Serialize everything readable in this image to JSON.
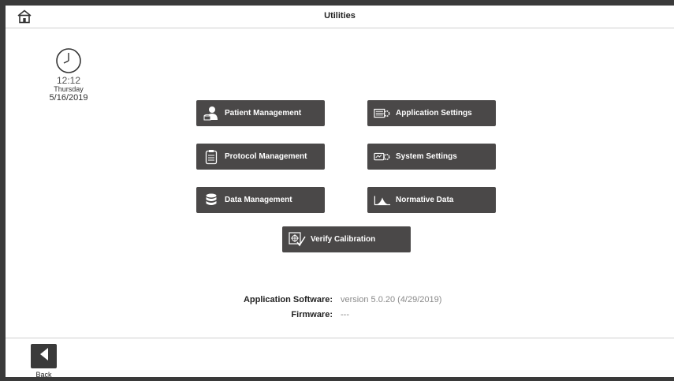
{
  "header": {
    "title": "Utilities",
    "home_icon": "home-icon"
  },
  "clock": {
    "time": "12:12",
    "day": "Thursday",
    "date": "5/16/2019",
    "icon": "clock-icon"
  },
  "buttons": {
    "patient_management": {
      "label": "Patient Management",
      "icon": "patient-icon"
    },
    "application_settings": {
      "label": "Application Settings",
      "icon": "app-settings-icon"
    },
    "protocol_management": {
      "label": "Protocol Management",
      "icon": "clipboard-icon"
    },
    "system_settings": {
      "label": "System Settings",
      "icon": "system-settings-icon"
    },
    "data_management": {
      "label": "Data Management",
      "icon": "database-icon"
    },
    "normative_data": {
      "label": "Normative Data",
      "icon": "bell-curve-icon"
    },
    "verify_calibration": {
      "label": "Verify Calibration",
      "icon": "calibration-icon"
    }
  },
  "info": {
    "app_software_label": "Application Software:",
    "app_software_value": "version 5.0.20 (4/29/2019)",
    "firmware_label": "Firmware:",
    "firmware_value": "---"
  },
  "footer": {
    "back_label": "Back",
    "back_icon": "back-arrow-icon"
  },
  "colors": {
    "button_bg": "#4a4848",
    "frame": "#3a3a3a",
    "value_text": "#8a8a8a"
  }
}
